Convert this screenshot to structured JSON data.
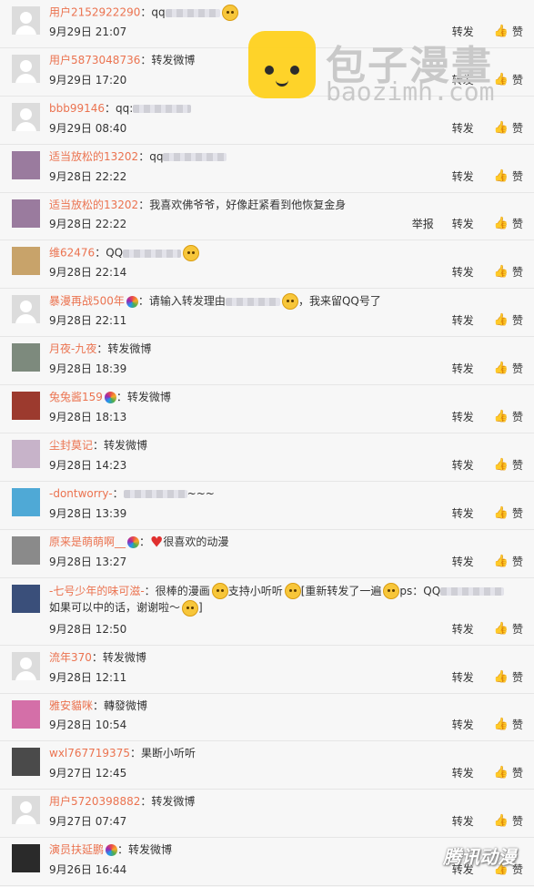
{
  "labels": {
    "repost": "转发",
    "like": "赞",
    "report": "举报"
  },
  "watermark": {
    "title": "包子漫畫",
    "url": "baozimh.com",
    "corner": "腾讯动漫"
  },
  "comments": [
    {
      "user": "用户2152922290",
      "content": "qq",
      "blur": 60,
      "emoji": true,
      "time": "9月29日 21:07",
      "avatar": "default"
    },
    {
      "user": "用户5873048736",
      "content": "转发微博",
      "time": "9月29日 17:20",
      "avatar": "default"
    },
    {
      "user": "bbb99146",
      "content": "qq:",
      "blur": 64,
      "time": "9月29日 08:40",
      "avatar": "default"
    },
    {
      "user": "适当放松的13202",
      "content": "qq",
      "blur": 70,
      "time": "9月28日 22:22",
      "avatar": "photo",
      "avatarColor": "#9a7b9e"
    },
    {
      "user": "适当放松的13202",
      "content": "我喜欢佛爷爷，好像赶紧看到他恢复金身",
      "time": "9月28日 22:22",
      "avatar": "photo",
      "avatarColor": "#9a7b9e",
      "report": true
    },
    {
      "user": "维62476",
      "content": "QQ",
      "blur": 64,
      "emoji": true,
      "time": "9月28日 22:14",
      "avatar": "photo",
      "avatarColor": "#c8a36a"
    },
    {
      "user": "暴漫再战500年",
      "badge": true,
      "content": "请输入转发理由",
      "blur": 60,
      "content2": "，我来留QQ号了",
      "emoji": true,
      "time": "9月28日 22:11",
      "avatar": "default"
    },
    {
      "user": "月夜-九夜",
      "content": "转发微博",
      "time": "9月28日 18:39",
      "avatar": "photo",
      "avatarColor": "#7d8a7d"
    },
    {
      "user": "兔兔酱159",
      "badge": true,
      "content": "转发微博",
      "time": "9月28日 18:13",
      "avatar": "photo",
      "avatarColor": "#9c3a2e"
    },
    {
      "user": "尘封莫记",
      "content": "转发微博",
      "time": "9月28日 14:23",
      "avatar": "photo",
      "avatarColor": "#c7b3c9"
    },
    {
      "user": "-dontworry-",
      "content": "",
      "blur": 70,
      "content2": "~~~",
      "time": "9月28日 13:39",
      "avatar": "photo",
      "avatarColor": "#4fa9d6"
    },
    {
      "user": "原来是萌萌啊__",
      "badge": true,
      "heart": true,
      "content": "很喜欢的动漫",
      "time": "9月28日 13:27",
      "avatar": "photo",
      "avatarColor": "#8a8a8a"
    },
    {
      "user": "-七号少年的味可滋-",
      "content": "很棒的漫画",
      "emoji": true,
      "content2": "支持小听听",
      "emoji2": true,
      "content3": "[重新转发了一遍",
      "emoji3": true,
      "content4": "ps：QQ",
      "blur2": 70,
      "content5": "如果可以中的话，谢谢啦～",
      "emoji4": true,
      "content6": "]",
      "time": "9月28日 12:50",
      "avatar": "photo",
      "avatarColor": "#3a4f7a",
      "tall": true
    },
    {
      "user": "流年370",
      "content": "转发微博",
      "time": "9月28日 12:11",
      "avatar": "default"
    },
    {
      "user": "雅安貓咪",
      "content": "轉發微博",
      "time": "9月28日 10:54",
      "avatar": "photo",
      "avatarColor": "#d46fa8"
    },
    {
      "user": "wxl767719375",
      "content": "果断小听听",
      "time": "9月27日 12:45",
      "avatar": "photo",
      "avatarColor": "#4a4a4a"
    },
    {
      "user": "用户5720398882",
      "content": "转发微博",
      "time": "9月27日 07:47",
      "avatar": "default"
    },
    {
      "user": "演员扶延鹏",
      "badge": true,
      "content": "转发微博",
      "time": "9月26日 16:44",
      "avatar": "photo",
      "avatarColor": "#2a2a2a"
    }
  ]
}
